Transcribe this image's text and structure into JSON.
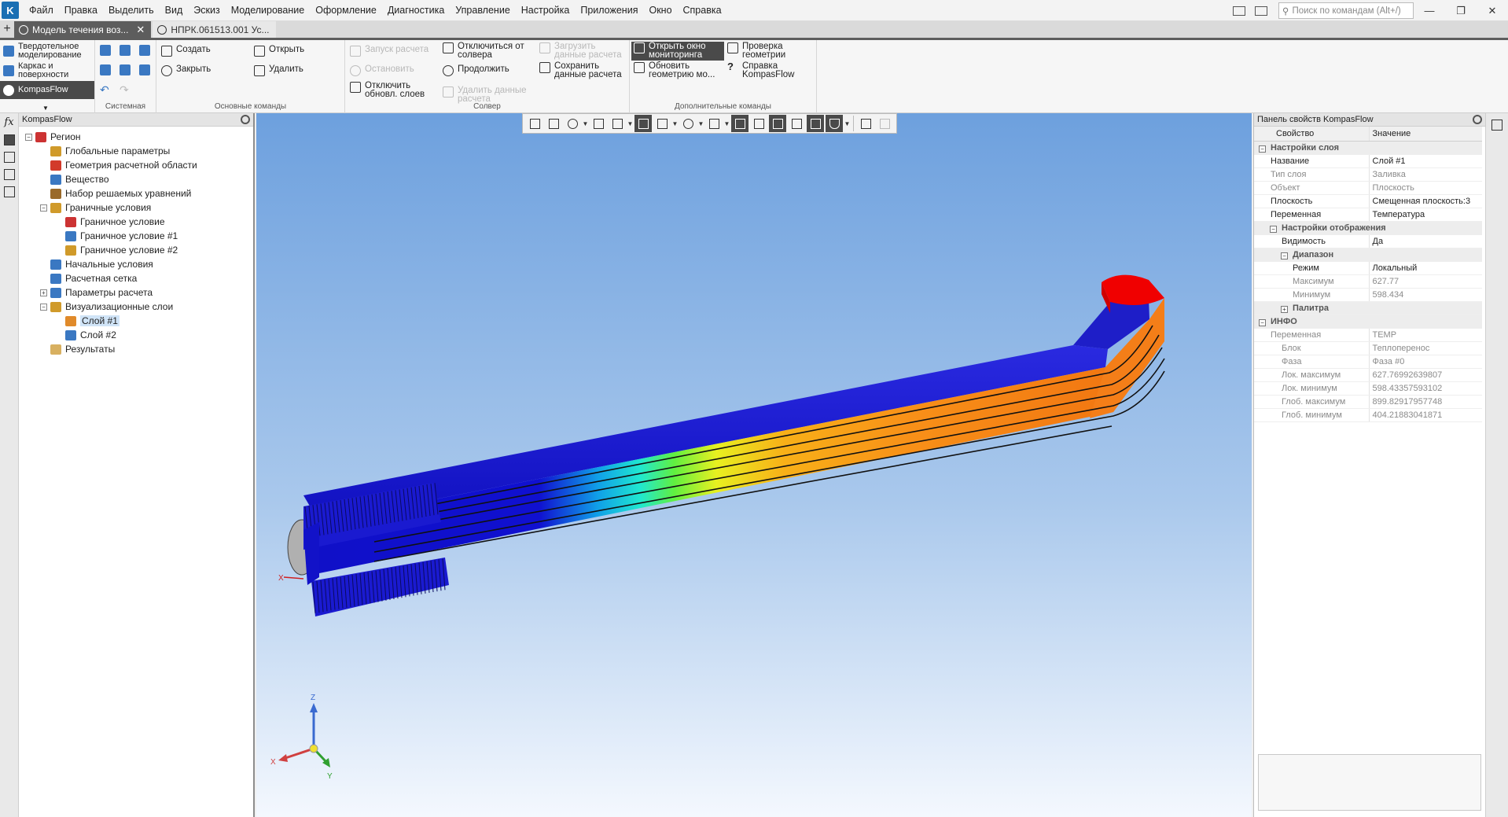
{
  "menu": {
    "items": [
      "Файл",
      "Правка",
      "Выделить",
      "Вид",
      "Эскиз",
      "Моделирование",
      "Оформление",
      "Диагностика",
      "Управление",
      "Настройка",
      "Приложения",
      "Окно",
      "Справка"
    ],
    "search_placeholder": "Поиск по командам (Alt+/)"
  },
  "tabs": {
    "active": "Модель течения воз...",
    "inactive": "НПРК.061513.001 Ус..."
  },
  "ribbon": {
    "modes": [
      "Твердотельное моделирование",
      "Каркас и поверхности",
      "KompasFlow"
    ],
    "system_label": "Системная",
    "main_group": {
      "label": "Основные команды",
      "create": "Создать",
      "open": "Открыть",
      "close": "Закрыть",
      "delete": "Удалить"
    },
    "solver_group": {
      "label": "Солвер",
      "start": "Запуск расчета",
      "stop": "Остановить",
      "disable_update": "Отключить обновл. слоев",
      "disconnect": "Отключиться от солвера",
      "continue": "Продолжить",
      "load_data": "Загрузить данные расчета",
      "save_data": "Сохранить данные расчета",
      "delete_data": "Удалить данные расчета"
    },
    "extra_group": {
      "label": "Дополнительные команды",
      "open_monitor": "Открыть окно мониторинга",
      "update_geometry": "Обновить геометрию мо...",
      "check_geometry": "Проверка геометрии",
      "help": "Справка KompasFlow"
    }
  },
  "tree": {
    "title": "KompasFlow",
    "items": [
      {
        "label": "Регион",
        "level": 0,
        "exp": "⊟",
        "color": "#c33"
      },
      {
        "label": "Глобальные параметры",
        "level": 1,
        "exp": "",
        "color": "#d09a2a"
      },
      {
        "label": "Геометрия расчетной области",
        "level": 1,
        "exp": "",
        "color": "#d23a2a"
      },
      {
        "label": "Вещество",
        "level": 1,
        "exp": "",
        "color": "#3a78c2"
      },
      {
        "label": "Набор решаемых уравнений",
        "level": 1,
        "exp": "",
        "color": "#9a6a2a"
      },
      {
        "label": "Граничные условия",
        "level": 1,
        "exp": "⊟",
        "color": "#d09a2a"
      },
      {
        "label": "Граничное условие",
        "level": 2,
        "exp": "",
        "color": "#c33"
      },
      {
        "label": "Граничное условие #1",
        "level": 2,
        "exp": "",
        "color": "#3a78c2"
      },
      {
        "label": "Граничное условие #2",
        "level": 2,
        "exp": "",
        "color": "#d09a2a"
      },
      {
        "label": "Начальные условия",
        "level": 1,
        "exp": "",
        "color": "#3a78c2"
      },
      {
        "label": "Расчетная сетка",
        "level": 1,
        "exp": "",
        "color": "#3a78c2"
      },
      {
        "label": "Параметры расчета",
        "level": 1,
        "exp": "⊞",
        "color": "#3a78c2"
      },
      {
        "label": "Визуализационные слои",
        "level": 1,
        "exp": "⊟",
        "color": "#d09a2a"
      },
      {
        "label": "Слой #1",
        "level": 2,
        "exp": "",
        "color": "#e08a2a",
        "selected": true
      },
      {
        "label": "Слой #2",
        "level": 2,
        "exp": "",
        "color": "#3a78c2"
      },
      {
        "label": "Результаты",
        "level": 1,
        "exp": "",
        "color": "#d8b060"
      }
    ]
  },
  "viewport": {
    "triad": {
      "x": "X",
      "y": "Y",
      "z": "Z"
    }
  },
  "props": {
    "title": "Панель свойств KompasFlow",
    "col_prop": "Свойство",
    "col_value": "Значение",
    "rows": [
      {
        "type": "section",
        "label": "Настройки слоя",
        "indent": 0
      },
      {
        "label": "Название",
        "value": "Слой #1",
        "gray": false,
        "indent": 0
      },
      {
        "label": "Тип слоя",
        "value": "Заливка",
        "gray": true,
        "indent": 0
      },
      {
        "label": "Объект",
        "value": "Плоскость",
        "gray": true,
        "indent": 0
      },
      {
        "label": "Плоскость",
        "value": "Смещенная плоскость:3",
        "gray": false,
        "indent": 0
      },
      {
        "label": "Переменная",
        "value": "Температура",
        "gray": false,
        "indent": 0
      },
      {
        "type": "section",
        "label": "Настройки отображения",
        "indent": 1
      },
      {
        "label": "Видимость",
        "value": "Да",
        "gray": false,
        "indent": 1
      },
      {
        "type": "section",
        "label": "Диапазон",
        "indent": 2
      },
      {
        "label": "Режим",
        "value": "Локальный",
        "gray": false,
        "indent": 2
      },
      {
        "label": "Максимум",
        "value": "627.77",
        "gray": true,
        "indent": 2
      },
      {
        "label": "Минимум",
        "value": "598.434",
        "gray": true,
        "indent": 2
      },
      {
        "type": "section",
        "label": "Палитра",
        "indent": 2,
        "collapsed": true
      },
      {
        "type": "section",
        "label": "ИНФО",
        "indent": 0
      },
      {
        "label": "Переменная",
        "value": "TEMP",
        "gray": true,
        "indent": 0
      },
      {
        "label": "Блок",
        "value": "Теплоперенос",
        "gray": true,
        "indent": 1
      },
      {
        "label": "Фаза",
        "value": "Фаза #0",
        "gray": true,
        "indent": 1
      },
      {
        "label": "Лок. максимум",
        "value": "627.76992639807",
        "gray": true,
        "indent": 1
      },
      {
        "label": "Лок. минимум",
        "value": "598.43357593102",
        "gray": true,
        "indent": 1
      },
      {
        "label": "Глоб. максимум",
        "value": "899.82917957748",
        "gray": true,
        "indent": 1
      },
      {
        "label": "Глоб. минимум",
        "value": "404.21883041871",
        "gray": true,
        "indent": 1
      }
    ]
  }
}
